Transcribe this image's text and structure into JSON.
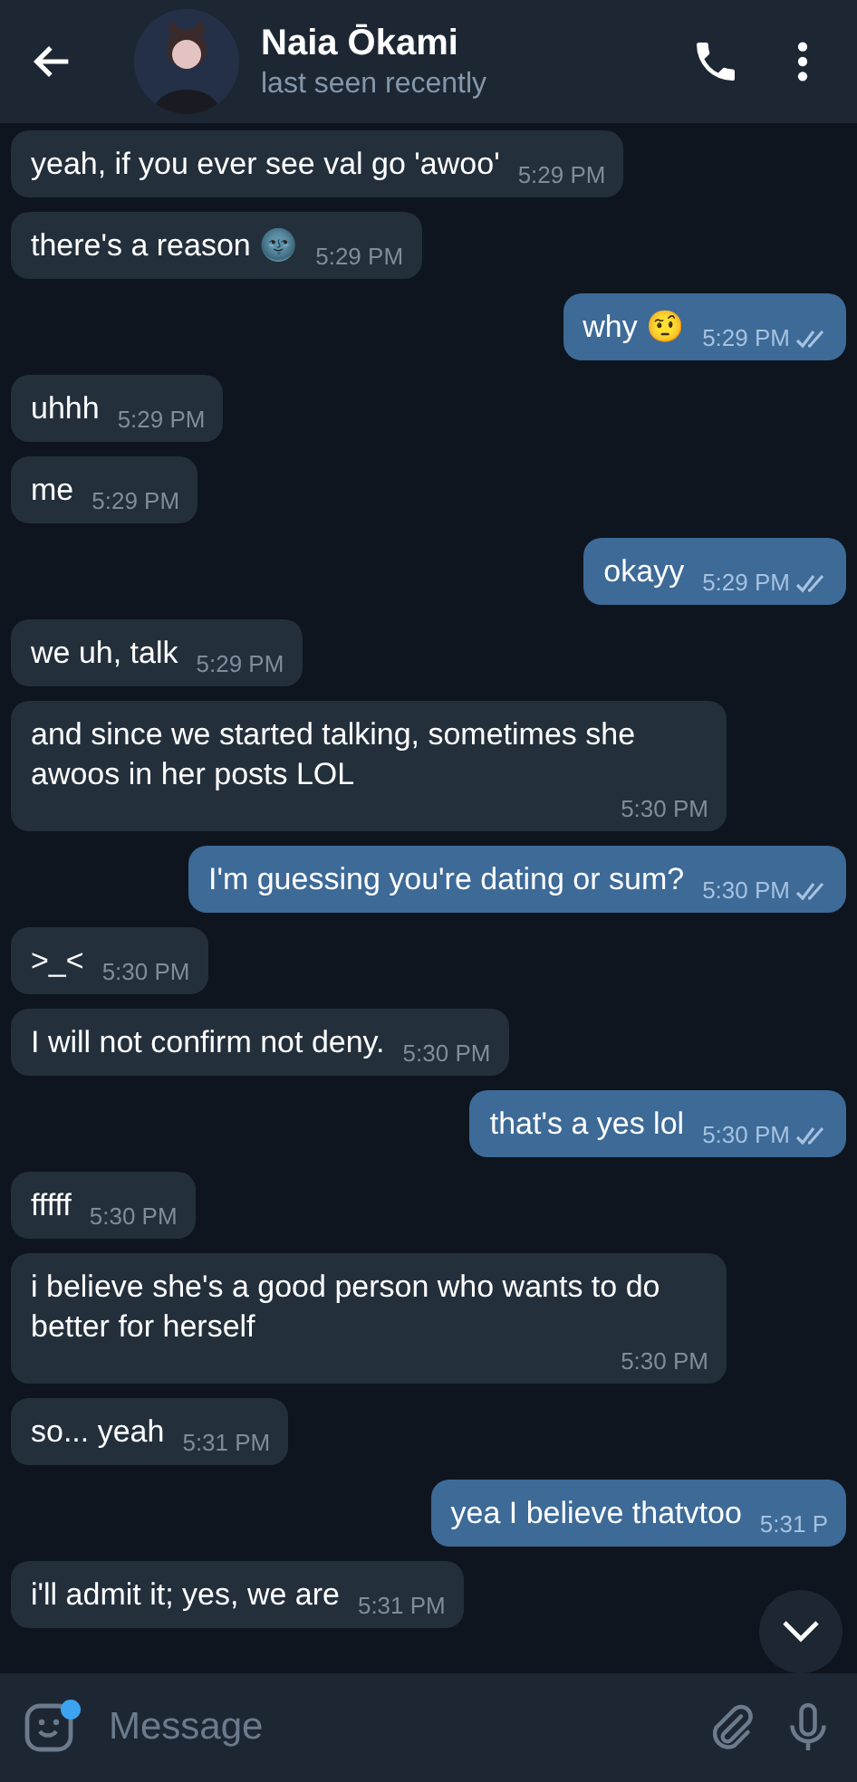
{
  "header": {
    "name": "Naia Ōkami",
    "status": "last seen recently"
  },
  "messages": [
    {
      "text": "yeah, if you ever see val go 'awoo'",
      "time": "5:29 PM",
      "outgoing": false
    },
    {
      "text": "there's a reason 🌚",
      "time": "5:29 PM",
      "outgoing": false
    },
    {
      "text": "why 🤨",
      "time": "5:29 PM",
      "outgoing": true,
      "read": true
    },
    {
      "text": "uhhh",
      "time": "5:29 PM",
      "outgoing": false
    },
    {
      "text": "me",
      "time": "5:29 PM",
      "outgoing": false
    },
    {
      "text": "okayy",
      "time": "5:29 PM",
      "outgoing": true,
      "read": true
    },
    {
      "text": "we uh, talk",
      "time": "5:29 PM",
      "outgoing": false
    },
    {
      "text": "and since we started talking, sometimes she awoos in her posts LOL",
      "time": "5:30 PM",
      "outgoing": false
    },
    {
      "text": "I'm guessing you're dating or sum?",
      "time": "5:30 PM",
      "outgoing": true,
      "read": true
    },
    {
      "text": ">_<",
      "time": "5:30 PM",
      "outgoing": false
    },
    {
      "text": "I will not confirm not deny.",
      "time": "5:30 PM",
      "outgoing": false
    },
    {
      "text": "that's a yes lol",
      "time": "5:30 PM",
      "outgoing": true,
      "read": true
    },
    {
      "text": "fffff",
      "time": "5:30 PM",
      "outgoing": false
    },
    {
      "text": "i believe she's a good person who wants to do better for herself",
      "time": "5:30 PM",
      "outgoing": false
    },
    {
      "text": "so... yeah",
      "time": "5:31 PM",
      "outgoing": false
    },
    {
      "text": "yea I believe thatvtoo",
      "time": "5:31 P",
      "outgoing": true
    },
    {
      "text": "i'll admit it; yes, we are",
      "time": "5:31 PM",
      "outgoing": false
    }
  ],
  "composer": {
    "placeholder": "Message",
    "sticker_badge": true
  }
}
